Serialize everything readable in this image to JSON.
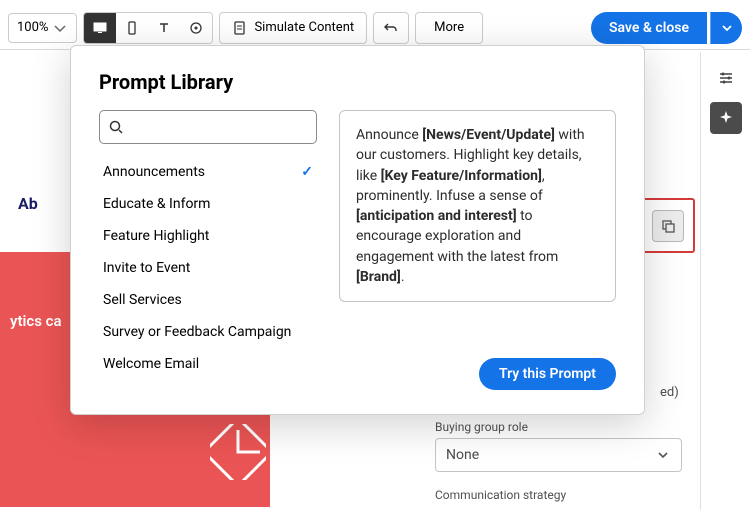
{
  "topbar": {
    "zoom": "100%",
    "simulate": "Simulate Content",
    "more": "More",
    "save_close": "Save & close"
  },
  "canvas": {
    "dark_label": "Ab",
    "red_text": "ytics ca"
  },
  "float": {
    "ed_suffix": "ed)"
  },
  "form": {
    "buying_group_label": "Buying group role",
    "buying_group_value": "None",
    "comm_strategy_label": "Communication strategy"
  },
  "modal": {
    "title": "Prompt Library",
    "search_placeholder": "",
    "items": [
      {
        "label": "Announcements",
        "selected": true
      },
      {
        "label": "Educate & Inform",
        "selected": false
      },
      {
        "label": "Feature Highlight",
        "selected": false
      },
      {
        "label": "Invite to Event",
        "selected": false
      },
      {
        "label": "Sell Services",
        "selected": false
      },
      {
        "label": "Survey or Feedback Campaign",
        "selected": false
      },
      {
        "label": "Welcome Email",
        "selected": false
      }
    ],
    "preview": {
      "p1a": "Announce ",
      "p1b": "[News/Event/Update]",
      "p1c": " with our customers. Highlight key details, like ",
      "p1d": "[Key Feature/Information]",
      "p1e": ", prominently. Infuse a sense of ",
      "p1f": "[anticipation and interest]",
      "p1g": " to encourage exploration and engagement with the latest from ",
      "p1h": "[Brand]",
      "p1i": "."
    },
    "try_label": "Try this Prompt"
  }
}
